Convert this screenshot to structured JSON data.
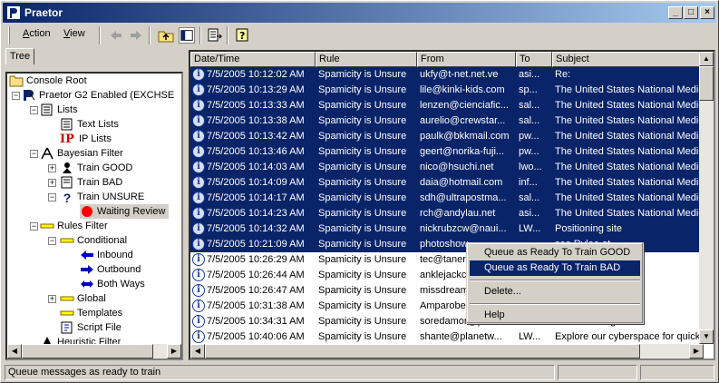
{
  "window": {
    "title": "Praetor",
    "minimize": "_",
    "maximize": "□",
    "close": "×"
  },
  "menu": [
    {
      "key": "A",
      "rest": "ction"
    },
    {
      "key": "V",
      "rest": "iew"
    }
  ],
  "toolbar": {
    "icons": [
      "back-arrow-icon",
      "forward-arrow-icon",
      "up-folder-icon",
      "show-hide-tree-icon",
      "export-list-icon",
      "help-icon"
    ]
  },
  "tree_tab": "Tree",
  "tree": [
    {
      "label": "Console Root",
      "icon": "folder-icon"
    },
    {
      "label": "Praetor G2 Enabled (EXCHSE",
      "icon": "praetor-icon"
    },
    {
      "label": "Lists",
      "icon": "lists-icon"
    },
    {
      "label": "Text Lists",
      "icon": "text-lists-icon"
    },
    {
      "label": "IP Lists",
      "icon": "ip-icon"
    },
    {
      "label": "Bayesian Filter",
      "icon": "bayesian-icon"
    },
    {
      "label": "Train GOOD",
      "icon": "train-good-icon"
    },
    {
      "label": "Train BAD",
      "icon": "train-bad-icon"
    },
    {
      "label": "Train UNSURE",
      "icon": "question-icon"
    },
    {
      "label": "Waiting Review",
      "icon": "red-dot-icon"
    },
    {
      "label": "Rules Filter",
      "icon": "rules-icon"
    },
    {
      "label": "Conditional",
      "icon": "conditional-icon"
    },
    {
      "label": "Inbound",
      "icon": "inbound-arrow-icon"
    },
    {
      "label": "Outbound",
      "icon": "outbound-arrow-icon"
    },
    {
      "label": "Both Ways",
      "icon": "both-ways-arrow-icon"
    },
    {
      "label": "Global",
      "icon": "global-icon"
    },
    {
      "label": "Templates",
      "icon": "templates-icon"
    },
    {
      "label": "Script File",
      "icon": "script-icon"
    },
    {
      "label": "Heuristic Filter",
      "icon": "heuristic-icon"
    }
  ],
  "ip_icon_text": "IP",
  "columns": [
    "Date/Time",
    "Rule",
    "From",
    "To",
    "Subject"
  ],
  "rows": [
    {
      "date": "7/5/2005 10:12:02 AM",
      "rule": "Spamicity is Unsure",
      "from": "ukfy@t-net.net.ve",
      "to": "asi...",
      "subject": "Re:",
      "selected": true
    },
    {
      "date": "7/5/2005 10:13:29 AM",
      "rule": "Spamicity is Unsure",
      "from": "lile@kinki-kids.com",
      "to": "sp...",
      "subject": "The United States National Medica",
      "selected": true
    },
    {
      "date": "7/5/2005 10:13:33 AM",
      "rule": "Spamicity is Unsure",
      "from": "lenzen@cienciafic...",
      "to": "sal...",
      "subject": "The United States National Medica",
      "selected": true
    },
    {
      "date": "7/5/2005 10:13:38 AM",
      "rule": "Spamicity is Unsure",
      "from": "aurelio@crewstar...",
      "to": "sal...",
      "subject": "The United States National Medica",
      "selected": true
    },
    {
      "date": "7/5/2005 10:13:42 AM",
      "rule": "Spamicity is Unsure",
      "from": "paulk@bkkmail.com",
      "to": "pw...",
      "subject": "The United States National Medica",
      "selected": true
    },
    {
      "date": "7/5/2005 10:13:46 AM",
      "rule": "Spamicity is Unsure",
      "from": "geert@norika-fuji...",
      "to": "pw...",
      "subject": "The United States National Medica",
      "selected": true
    },
    {
      "date": "7/5/2005 10:14:03 AM",
      "rule": "Spamicity is Unsure",
      "from": "nico@hsuchi.net",
      "to": "lwo...",
      "subject": "The United States National Medica",
      "selected": true
    },
    {
      "date": "7/5/2005 10:14:09 AM",
      "rule": "Spamicity is Unsure",
      "from": "daia@hotmail.com",
      "to": "inf...",
      "subject": "The United States National Medica",
      "selected": true
    },
    {
      "date": "7/5/2005 10:14:17 AM",
      "rule": "Spamicity is Unsure",
      "from": "sdh@ultrapostma...",
      "to": "sal...",
      "subject": "The United States National Medica",
      "selected": true
    },
    {
      "date": "7/5/2005 10:14:23 AM",
      "rule": "Spamicity is Unsure",
      "from": "rch@andylau.net",
      "to": "asi...",
      "subject": "The United States National Medica",
      "selected": true
    },
    {
      "date": "7/5/2005 10:14:32 AM",
      "rule": "Spamicity is Unsure",
      "from": "nickrubzcw@naui...",
      "to": "LW...",
      "subject": "Positioning site",
      "selected": true
    },
    {
      "date": "7/5/2005 10:21:09 AM",
      "rule": "Spamicity is Unsure",
      "from": "photoshow",
      "to": "",
      "subject": "see Rylee at",
      "selected": true
    },
    {
      "date": "7/5/2005 10:26:29 AM",
      "rule": "Spamicity is Unsure",
      "from": "tec@taner",
      "to": "",
      "subject": "",
      "selected": false
    },
    {
      "date": "7/5/2005 10:26:44 AM",
      "rule": "Spamicity is Unsure",
      "from": "anklejackc",
      "to": "",
      "subject": "nd Users",
      "selected": false
    },
    {
      "date": "7/5/2005 10:26:47 AM",
      "rule": "Spamicity is Unsure",
      "from": "missdream",
      "to": "",
      "subject": "Users",
      "selected": false
    },
    {
      "date": "7/5/2005 10:31:38 AM",
      "rule": "Spamicity is Unsure",
      "from": "Amparobe",
      "to": "",
      "subject": "nd Users",
      "selected": false
    },
    {
      "date": "7/5/2005 10:34:31 AM",
      "rule": "Spamicity is Unsure",
      "from": "soredamor@planet...",
      "to": "",
      "subject": "medicants sig",
      "selected": false
    },
    {
      "date": "7/5/2005 10:40:06 AM",
      "rule": "Spamicity is Unsure",
      "from": "shante@planetw...",
      "to": "LW...",
      "subject": "Explore our cyberspace for quick",
      "selected": false
    }
  ],
  "context_menu": {
    "items": [
      "Queue as Ready To Train GOOD",
      "Queue as Ready To Train BAD",
      "Delete...",
      "Help"
    ],
    "highlighted": 1
  },
  "status": {
    "text": "Queue messages as ready to train"
  },
  "colors": {
    "selection": "#0a246a",
    "title_start": "#0a246a",
    "title_end": "#a6caf0"
  }
}
